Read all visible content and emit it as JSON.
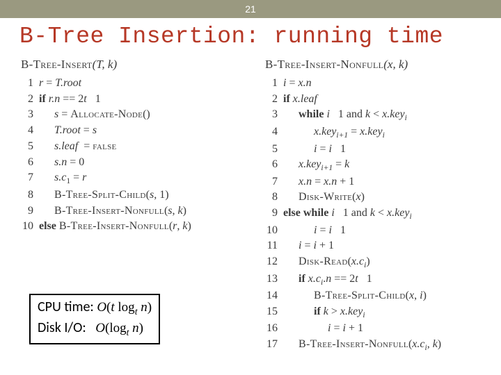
{
  "page_number": "21",
  "title": "B-Tree Insertion: running time",
  "left": {
    "fn_name": "B-Tree-Insert",
    "fn_args": "(T, k)",
    "lines": [
      {
        "indent": 0,
        "html": "<span class='it'>r</span> = <span class='it'>T.root</span>"
      },
      {
        "indent": 0,
        "html": "<span class='bf'>if</span> <span class='it'>r.n</span> == 2<span class='it'>t</span>&nbsp;&nbsp;&nbsp;1"
      },
      {
        "indent": 1,
        "html": "<span class='it'>s</span> = <span class='sc'>Allocate-Node</span>()"
      },
      {
        "indent": 1,
        "html": "<span class='it'>T.root</span> = <span class='it'>s</span>"
      },
      {
        "indent": 1,
        "html": "<span class='it'>s.leaf</span>&nbsp; = <span class='sc'>false</span>"
      },
      {
        "indent": 1,
        "html": "<span class='it'>s.n</span> = 0"
      },
      {
        "indent": 1,
        "html": "<span class='it'>s.c</span><span class='subn'>1</span> = <span class='it'>r</span>"
      },
      {
        "indent": 1,
        "html": "<span class='sc'>B-Tree-Split-Child</span>(<span class='it'>s</span>, 1)"
      },
      {
        "indent": 1,
        "html": "<span class='sc'>B-Tree-Insert-Nonfull</span>(<span class='it'>s</span>, <span class='it'>k</span>)"
      },
      {
        "indent": 0,
        "html": "<span class='bf'>else</span> <span class='sc'>B-Tree-Insert-Nonfull</span>(<span class='it'>r</span>, <span class='it'>k</span>)"
      }
    ]
  },
  "right": {
    "fn_name": "B-Tree-Insert-Nonfull",
    "fn_args": "(x, k)",
    "lines": [
      {
        "indent": 0,
        "html": "<span class='it'>i</span> = <span class='it'>x.n</span>"
      },
      {
        "indent": 0,
        "html": "<span class='bf'>if</span> <span class='it'>x.leaf</span>"
      },
      {
        "indent": 1,
        "html": "<span class='bf'>while</span> <span class='it'>i</span>&nbsp;&nbsp;&nbsp;1 and <span class='it'>k</span> &lt; <span class='it'>x.key</span><span class='sub'>i</span>"
      },
      {
        "indent": 2,
        "html": "<span class='it'>x.key</span><span class='sub'>i+1</span> = <span class='it'>x.key</span><span class='sub'>i</span>"
      },
      {
        "indent": 2,
        "html": "<span class='it'>i</span> = <span class='it'>i</span>&nbsp;&nbsp;&nbsp;1"
      },
      {
        "indent": 1,
        "html": "<span class='it'>x.key</span><span class='sub'>i+1</span> = <span class='it'>k</span>"
      },
      {
        "indent": 1,
        "html": "<span class='it'>x.n</span> = <span class='it'>x.n</span> + 1"
      },
      {
        "indent": 1,
        "html": "<span class='sc'>Disk-Write</span>(<span class='it'>x</span>)"
      },
      {
        "indent": 0,
        "html": "<span class='bf'>else while</span> <span class='it'>i</span>&nbsp;&nbsp;&nbsp;1 and <span class='it'>k</span> &lt; <span class='it'>x.key</span><span class='sub'>i</span>"
      },
      {
        "indent": 2,
        "html": "<span class='it'>i</span> = <span class='it'>i</span>&nbsp;&nbsp;&nbsp;1"
      },
      {
        "indent": 1,
        "html": "<span class='it'>i</span> = <span class='it'>i</span> + 1"
      },
      {
        "indent": 1,
        "html": "<span class='sc'>Disk-Read</span>(<span class='it'>x.c</span><span class='sub'>i</span>)"
      },
      {
        "indent": 1,
        "html": "<span class='bf'>if</span> <span class='it'>x.c</span><span class='sub'>i</span>.<span class='it'>n</span> == 2<span class='it'>t</span>&nbsp;&nbsp;&nbsp;1"
      },
      {
        "indent": 2,
        "html": "<span class='sc'>B-Tree-Split-Child</span>(<span class='it'>x</span>, <span class='it'>i</span>)"
      },
      {
        "indent": 2,
        "html": "<span class='bf'>if</span> <span class='it'>k</span> &gt; <span class='it'>x.key</span><span class='sub'>i</span>"
      },
      {
        "indent": 3,
        "html": "<span class='it'>i</span> = <span class='it'>i</span> + 1"
      },
      {
        "indent": 1,
        "html": "<span class='sc'>B-Tree-Insert-Nonfull</span>(<span class='it'>x.c</span><span class='sub'>i</span>, <span class='it'>k</span>)"
      }
    ]
  },
  "complexity": {
    "cpu_label": "CPU time:",
    "cpu_value_html": "<span class='it'>O</span><span class='rm'>(</span><span class='it'>t</span> <span class='rm'>log</span><span class='sub'>t</span> <span class='it'>n</span><span class='rm'>)</span>",
    "disk_label": "Disk I/O:",
    "disk_value_html": "<span class='it'>O</span><span class='rm'>(</span><span class='rm'>log</span><span class='sub'>t</span> <span class='it'>n</span><span class='rm'>)</span>"
  }
}
